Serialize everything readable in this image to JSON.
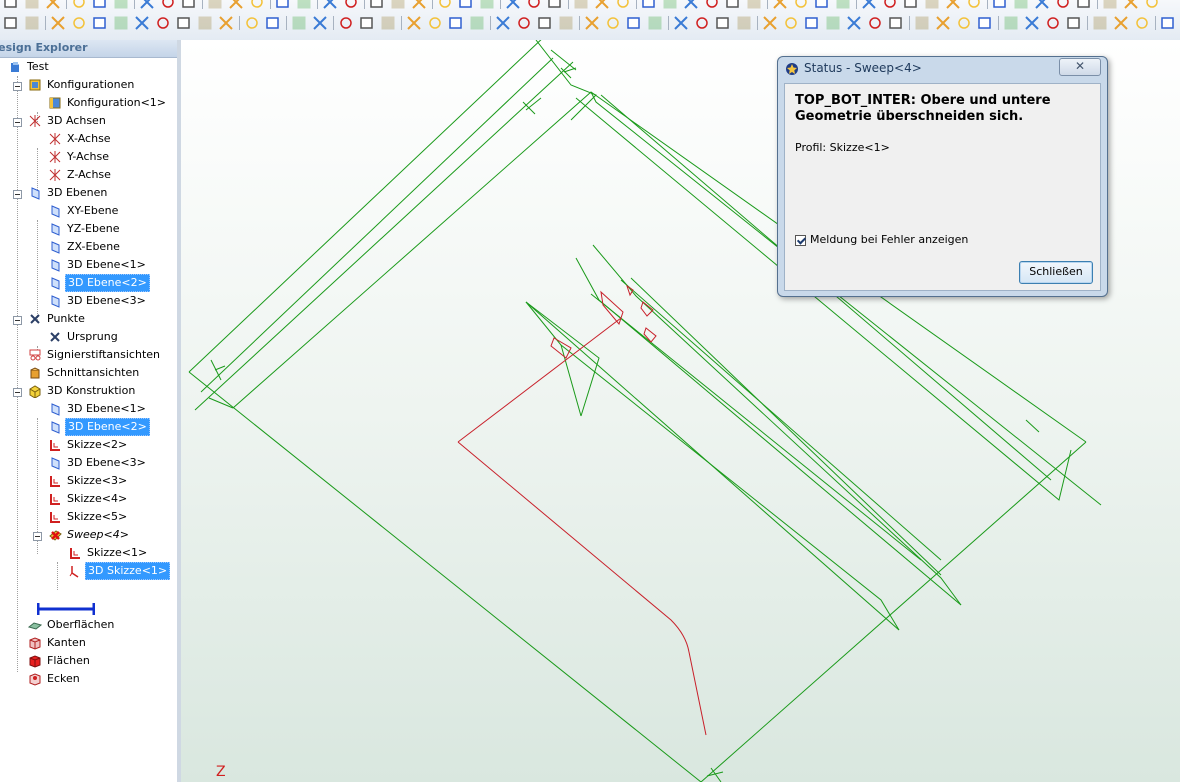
{
  "explorer": {
    "title": "Design Explorer",
    "items": [
      {
        "label": "Test",
        "icon": "model-icon"
      },
      {
        "label": "Konfigurationen",
        "icon": "configurations-icon"
      },
      {
        "label": "Konfiguration<1>",
        "icon": "configuration-icon"
      },
      {
        "label": "3D Achsen",
        "icon": "axes-icon"
      },
      {
        "label": "X-Achse",
        "icon": "axis-icon"
      },
      {
        "label": "Y-Achse",
        "icon": "axis-icon"
      },
      {
        "label": "Z-Achse",
        "icon": "axis-icon"
      },
      {
        "label": "3D Ebenen",
        "icon": "planes-icon"
      },
      {
        "label": "XY-Ebene",
        "icon": "plane-icon"
      },
      {
        "label": "YZ-Ebene",
        "icon": "plane-icon"
      },
      {
        "label": "ZX-Ebene",
        "icon": "plane-icon"
      },
      {
        "label": "3D Ebene<1>",
        "icon": "plane-icon"
      },
      {
        "label": "3D Ebene<2>",
        "icon": "plane-icon"
      },
      {
        "label": "3D Ebene<3>",
        "icon": "plane-icon"
      },
      {
        "label": "Punkte",
        "icon": "points-icon"
      },
      {
        "label": "Ursprung",
        "icon": "point-icon"
      },
      {
        "label": "Signierstiftansichten",
        "icon": "marker-views-icon"
      },
      {
        "label": "Schnittansichten",
        "icon": "section-views-icon"
      },
      {
        "label": "3D Konstruktion",
        "icon": "construction-icon"
      },
      {
        "label": "3D Ebene<1>",
        "icon": "plane-icon"
      },
      {
        "label": "3D Ebene<2>",
        "icon": "plane-icon"
      },
      {
        "label": "Skizze<2>",
        "icon": "sketch-icon"
      },
      {
        "label": "3D Ebene<3>",
        "icon": "plane-icon"
      },
      {
        "label": "Skizze<3>",
        "icon": "sketch-icon"
      },
      {
        "label": "Skizze<4>",
        "icon": "sketch-icon"
      },
      {
        "label": "Skizze<5>",
        "icon": "sketch-icon"
      },
      {
        "label": "Sweep<4>",
        "icon": "sweep-error-icon"
      },
      {
        "label": "Skizze<1>",
        "icon": "sketch-icon"
      },
      {
        "label": "3D Skizze<1>",
        "icon": "sketch3d-icon"
      },
      {
        "label": "",
        "icon": "rollback-bar-icon"
      },
      {
        "label": "Oberflächen",
        "icon": "surfaces-icon"
      },
      {
        "label": "Kanten",
        "icon": "edges-icon"
      },
      {
        "label": "Flächen",
        "icon": "faces-icon"
      },
      {
        "label": "Ecken",
        "icon": "vertices-icon"
      }
    ]
  },
  "viewport": {
    "axis_label": "Z",
    "colors": {
      "wireframe": "#1a9a1a",
      "sketch": "#c8202a"
    }
  },
  "dialog": {
    "title": "Status  - Sweep<4>",
    "close_label": "✕",
    "message": "TOP_BOT_INTER:  Obere und untere Geometrie überschneiden sich.",
    "profile": "Profil: Skizze<1>",
    "checkbox_label": "Meldung bei Fehler anzeigen",
    "checkbox_checked": true,
    "button_label": "Schließen"
  }
}
